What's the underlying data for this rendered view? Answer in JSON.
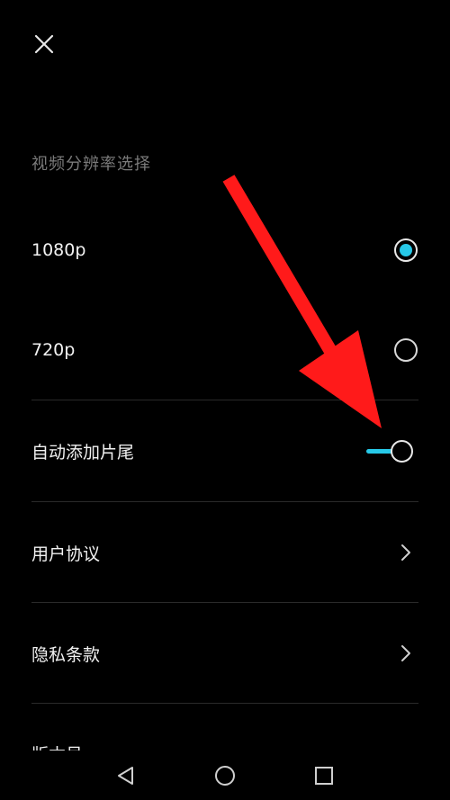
{
  "header": {
    "close_icon": "close-icon"
  },
  "resolution": {
    "section_title": "视频分辨率选择",
    "options": [
      {
        "label": "1080p",
        "selected": true
      },
      {
        "label": "720p",
        "selected": false
      }
    ]
  },
  "settings": {
    "auto_outro_label": "自动添加片尾",
    "auto_outro_enabled": true,
    "user_agreement_label": "用户协议",
    "privacy_policy_label": "隐私条款",
    "version_label": "版本号"
  },
  "nav": {
    "back_icon": "back-triangle-icon",
    "home_icon": "home-circle-icon",
    "recents_icon": "recents-square-icon"
  },
  "colors": {
    "background": "#000000",
    "accent": "#27c9e8",
    "annotation_arrow": "#ff1a1a",
    "section_title": "#7a7a7a",
    "divider": "#2a2a2a"
  }
}
